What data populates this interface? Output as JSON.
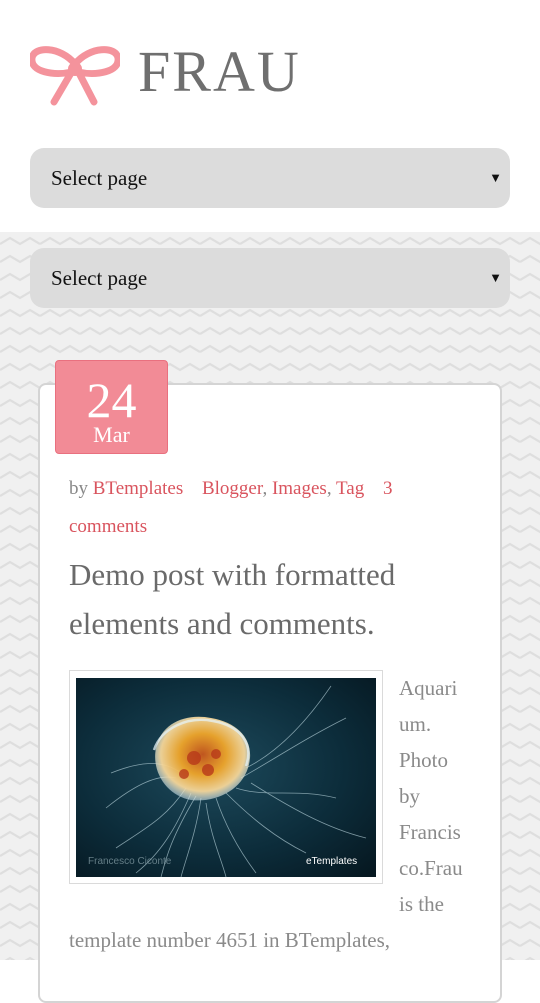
{
  "site": {
    "title": "FRAU"
  },
  "nav": [
    {
      "label": "Select page",
      "arrow": "▼"
    },
    {
      "label": "Select page",
      "arrow": "▼"
    }
  ],
  "post": {
    "date": {
      "day": "24",
      "month": "Mar"
    },
    "meta": {
      "by": "by",
      "author": "BTemplates",
      "labels": [
        "Blogger",
        "Images",
        "Tag"
      ],
      "comments_count": "3",
      "comments_label": "comments"
    },
    "title": "Demo post with formatted elements and comments.",
    "image": {
      "watermark_left": "Francesco Ciconte",
      "watermark_right": "eTemplates"
    },
    "body_wrapped": [
      "Aquari",
      "um.",
      "Photo",
      "by",
      "Francis",
      "co.Frau",
      "is the"
    ],
    "body_line": "template number 4651 in BTemplates,"
  },
  "colors": {
    "accent": "#f28b96",
    "link": "#d9545e",
    "text": "#8a8a8a"
  }
}
